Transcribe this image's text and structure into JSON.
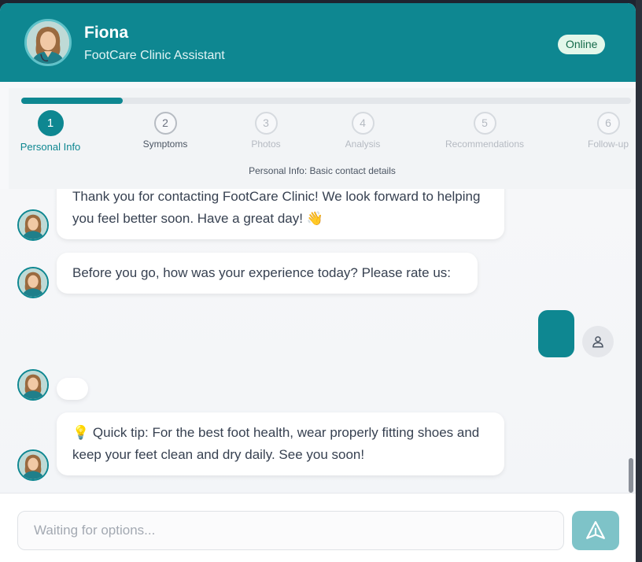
{
  "header": {
    "name": "Fiona",
    "subtitle": "FootCare Clinic Assistant",
    "status": "Online"
  },
  "stepper": {
    "progress_fraction": 0.167,
    "steps": [
      {
        "number": "1",
        "label": "Personal Info",
        "state": "active"
      },
      {
        "number": "2",
        "label": "Symptoms",
        "state": "next"
      },
      {
        "number": "3",
        "label": "Photos",
        "state": "pending"
      },
      {
        "number": "4",
        "label": "Analysis",
        "state": "pending"
      },
      {
        "number": "5",
        "label": "Recommendations",
        "state": "pending"
      },
      {
        "number": "6",
        "label": "Follow-up",
        "state": "pending"
      }
    ],
    "caption": "Personal Info: Basic contact details"
  },
  "messages": {
    "m1": "Thank you for contacting FootCare Clinic! We look forward to helping you feel better soon. Have a great day! 👋",
    "m2": "Before you go, how was your experience today? Please rate us:",
    "m3": "",
    "m4": "💡 Quick tip: For the best foot health, wear properly fitting shoes and keep your feet clean and dry daily. See you soon!"
  },
  "input": {
    "placeholder": "Waiting for options...",
    "value": ""
  },
  "icons": {
    "send": "send-icon",
    "user": "user-icon",
    "avatar": "doctor-avatar"
  },
  "colors": {
    "accent": "#0e8791",
    "badge_bg": "#e3f7ea",
    "send_disabled": "#7ec3c8"
  }
}
